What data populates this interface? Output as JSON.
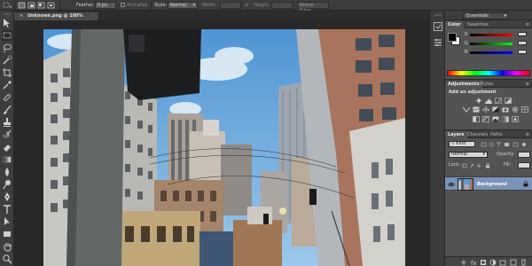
{
  "options_bar": {
    "feather_label": "Feather:",
    "feather_value": "0 px",
    "antialias_label": "Anti-alias",
    "style_label": "Style:",
    "style_value": "Normal",
    "width_label": "Width:",
    "height_label": "Height:",
    "refine_edge_label": "Refine Edge..."
  },
  "document": {
    "tab_title": "Unknown.png @ 100% (RGB/8)",
    "close_glyph": "×"
  },
  "workspace": {
    "switcher_label": "Essentials"
  },
  "color_panel": {
    "tabs": [
      "Color",
      "Swatches"
    ],
    "active_tab": "Color",
    "channel_labels": [
      "R",
      "G",
      "B"
    ],
    "fg_color": "#000000",
    "bg_color": "#ffffff"
  },
  "adjustments_panel": {
    "tabs": [
      "Adjustments",
      "Styles"
    ],
    "active_tab": "Adjustments",
    "heading": "Add an adjustment",
    "icons": [
      "brightness-icon",
      "levels-icon",
      "curves-icon",
      "exposure-icon",
      "vibrance-icon",
      "hue-saturation-icon",
      "color-balance-icon",
      "black-white-icon",
      "photo-filter-icon",
      "channel-mixer-icon",
      "color-lookup-icon",
      "invert-icon",
      "posterize-icon",
      "threshold-icon",
      "gradient-map-icon",
      "selective-color-icon"
    ]
  },
  "layers_panel": {
    "tabs": [
      "Layers",
      "Channels",
      "Paths"
    ],
    "active_tab": "Layers",
    "filter_value": "Kind",
    "blend_mode": "Normal",
    "opacity_label": "Opacity:",
    "lock_label": "Lock:",
    "fill_label": "Fill:",
    "layers": [
      {
        "name": "Background",
        "visible": true,
        "selected": true
      }
    ]
  },
  "panel_menu_glyph": "≡",
  "colors": {
    "ui_dark": "#3c3c3c",
    "ui_mid": "#535353",
    "workspace_bg": "#282828",
    "selection_blue": "#7a93b8"
  }
}
